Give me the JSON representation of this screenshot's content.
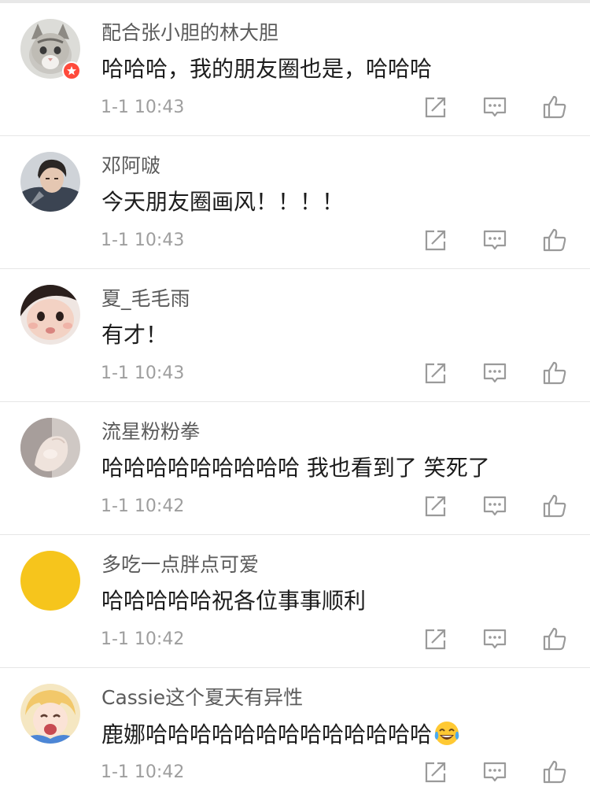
{
  "comments": [
    {
      "username": "配合张小胆的林大胆",
      "text": "哈哈哈，我的朋友圈也是，哈哈哈",
      "time": "1-1 10:43",
      "avatar": "cat-avatar",
      "verified": true
    },
    {
      "username": "邓阿啵",
      "text": "今天朋友圈画风！！！！",
      "time": "1-1 10:43",
      "avatar": "man-photo-avatar",
      "verified": false
    },
    {
      "username": "夏_毛毛雨",
      "text": "有才！",
      "time": "1-1 10:43",
      "avatar": "child-photo-avatar",
      "verified": false
    },
    {
      "username": "流星粉粉拳",
      "text": "哈哈哈哈哈哈哈哈哈 我也看到了 笑死了",
      "time": "1-1 10:42",
      "avatar": "hand-photo-avatar",
      "verified": false
    },
    {
      "username": "多吃一点胖点可爱",
      "text": "哈哈哈哈哈祝各位事事顺利",
      "time": "1-1 10:42",
      "avatar": "yellow-circle-avatar",
      "verified": false
    },
    {
      "username": "Cassie这个夏天有异性",
      "text": "鹿娜哈哈哈哈哈哈哈哈哈哈哈哈哈",
      "time": "1-1 10:42",
      "avatar": "anime-girl-avatar",
      "verified": false,
      "emoji": "tears-of-joy-emoji"
    }
  ],
  "actions": {
    "repost_icon": "repost-icon",
    "reply_icon": "comment-icon",
    "like_icon": "thumbs-up-icon"
  },
  "colors": {
    "username": "#5b5b5b",
    "text": "#1c1c1c",
    "time": "#9e9e9e",
    "badge": "#ff4a3b",
    "divider": "#e6e6e6",
    "yellow_avatar": "#f6c51c"
  }
}
